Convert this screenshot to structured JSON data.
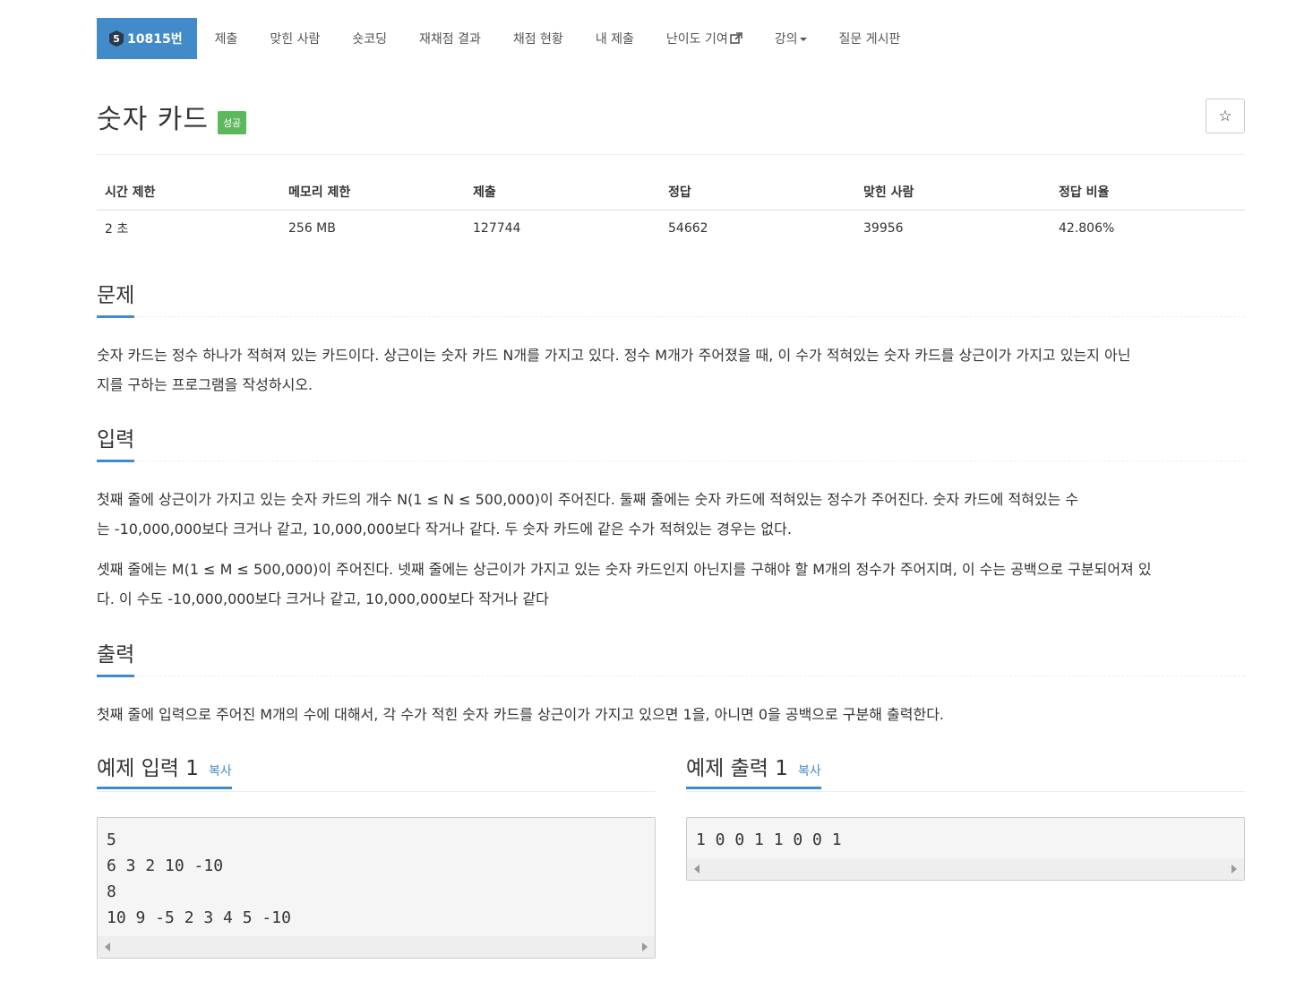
{
  "nav": {
    "problem_tier": "5",
    "problem_number": "10815번",
    "items": [
      "제출",
      "맞힌 사람",
      "숏코딩",
      "재채점 결과",
      "채점 현황",
      "내 제출",
      "난이도 기여",
      "강의",
      "질문 게시판"
    ]
  },
  "problem": {
    "title": "숫자 카드",
    "result_badge": "성공"
  },
  "info": {
    "headers": [
      "시간 제한",
      "메모리 제한",
      "제출",
      "정답",
      "맞힌 사람",
      "정답 비율"
    ],
    "values": [
      "2 초",
      "256 MB",
      "127744",
      "54662",
      "39956",
      "42.806%"
    ]
  },
  "sections": {
    "description_title": "문제",
    "description_lines": [
      "숫자 카드는 정수 하나가 적혀져 있는 카드이다. 상근이는 숫자 카드 N개를 가지고 있다. 정수 M개가 주어졌을 때, 이 수가 적혀있는 숫자 카드를 상근이가 가지고 있는지 아닌",
      "지를 구하는 프로그램을 작성하시오."
    ],
    "input_title": "입력",
    "input_lines": [
      "첫째 줄에 상근이가 가지고 있는 숫자 카드의 개수 N(1 ≤ N ≤ 500,000)이 주어진다. 둘째 줄에는 숫자 카드에 적혀있는 정수가 주어진다. 숫자 카드에 적혀있는 수",
      "는 -10,000,000보다 크거나 같고, 10,000,000보다 작거나 같다. 두 숫자 카드에 같은 수가 적혀있는 경우는 없다.",
      "셋째 줄에는 M(1 ≤ M ≤ 500,000)이 주어진다. 넷째 줄에는 상근이가 가지고 있는 숫자 카드인지 아닌지를 구해야 할 M개의 정수가 주어지며, 이 수는 공백으로 구분되어져 있",
      "다. 이 수도 -10,000,000보다 크거나 같고, 10,000,000보다 작거나 같다"
    ],
    "output_title": "출력",
    "output_line": "첫째 줄에 입력으로 주어진 M개의 수에 대해서, 각 수가 적힌 숫자 카드를 상근이가 가지고 있으면 1을, 아니면 0을 공백으로 구분해 출력한다."
  },
  "samples": {
    "input_title": "예제 입력 1",
    "output_title": "예제 출력 1",
    "copy_label": "복사",
    "input_lines": [
      "5",
      "6 3 2 10 -10",
      "8",
      "10 9 -5 2 3 4 5 -10"
    ],
    "output_lines": [
      "1 0 0 1 1 0 0 1"
    ]
  },
  "colors": {
    "accent": "#428bca",
    "success": "#5cb85c"
  },
  "icons": [
    "star-icon",
    "external-link-icon",
    "caret-down-icon",
    "tier-badge-icon"
  ]
}
